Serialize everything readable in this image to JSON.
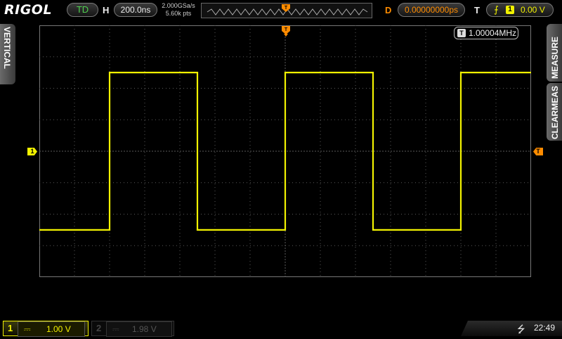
{
  "brand": "RIGOL",
  "status": {
    "mode": "TD"
  },
  "horizontal": {
    "label": "H",
    "timebase": "200.0ns",
    "sample_rate": "2.000GSa/s",
    "memory_depth": "5.60k pts"
  },
  "delay": {
    "label": "D",
    "value": "0.00000000ps"
  },
  "trigger": {
    "label": "T",
    "source": "1",
    "level": "0.00 V",
    "marker": "T"
  },
  "side_tabs": {
    "left": "VERTICAL",
    "right_top": "MEASURE",
    "right_bottom": "CLEARMEAS"
  },
  "measurement": {
    "icon": "T",
    "value": "1.00004MHz"
  },
  "markers": {
    "ch1_ground": "1",
    "trigger_level": "T"
  },
  "channels": [
    {
      "num": "1",
      "scale": "1.00 V",
      "active": true
    },
    {
      "num": "2",
      "scale": "1.98 V",
      "active": false
    }
  ],
  "clock": "22:49",
  "colors": {
    "ch1": "#f2f200",
    "trigger": "#ff8c00",
    "grid": "#5a5a5a"
  },
  "waveform": {
    "type": "square",
    "high_level_div": 2.5,
    "low_level_div": -2.5,
    "period_div": 5.0,
    "first_rise_div": 2.0
  }
}
